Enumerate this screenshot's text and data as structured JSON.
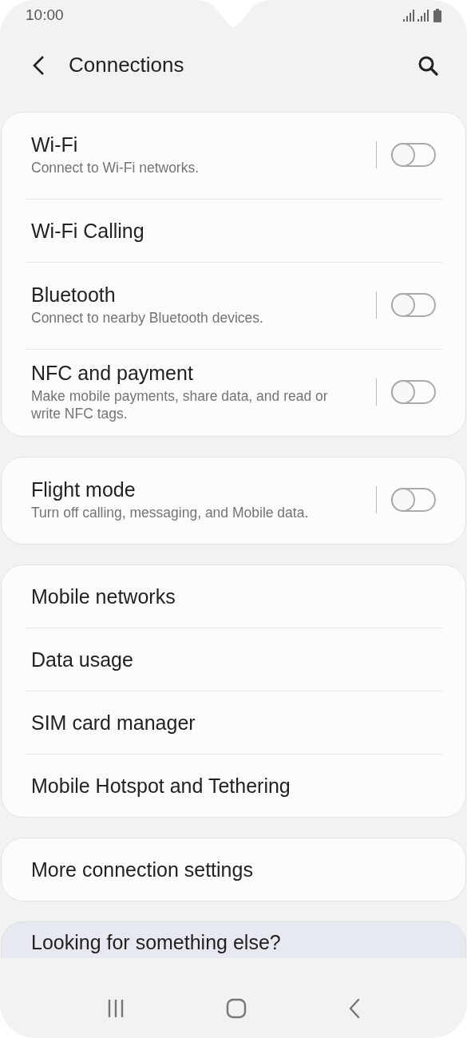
{
  "status_bar": {
    "time": "10:00"
  },
  "header": {
    "title": "Connections"
  },
  "groups": [
    {
      "items": [
        {
          "kind": "switch",
          "title": "Wi-Fi",
          "subtitle": "Connect to Wi-Fi networks.",
          "on": false
        },
        {
          "kind": "link",
          "title": "Wi-Fi Calling"
        },
        {
          "kind": "switch",
          "title": "Bluetooth",
          "subtitle": "Connect to nearby Bluetooth devices.",
          "on": false
        },
        {
          "kind": "switch",
          "title": "NFC and payment",
          "subtitle": "Make mobile payments, share data, and read or write NFC tags.",
          "on": false
        }
      ]
    },
    {
      "items": [
        {
          "kind": "switch",
          "title": "Flight mode",
          "subtitle": "Turn off calling, messaging, and Mobile data.",
          "on": false
        }
      ]
    },
    {
      "items": [
        {
          "kind": "link",
          "title": "Mobile networks"
        },
        {
          "kind": "link",
          "title": "Data usage"
        },
        {
          "kind": "link",
          "title": "SIM card manager"
        },
        {
          "kind": "link",
          "title": "Mobile Hotspot and Tethering"
        }
      ]
    },
    {
      "items": [
        {
          "kind": "link",
          "title": "More connection settings"
        }
      ]
    }
  ],
  "suggestion_card": {
    "title": "Looking for something else?"
  }
}
